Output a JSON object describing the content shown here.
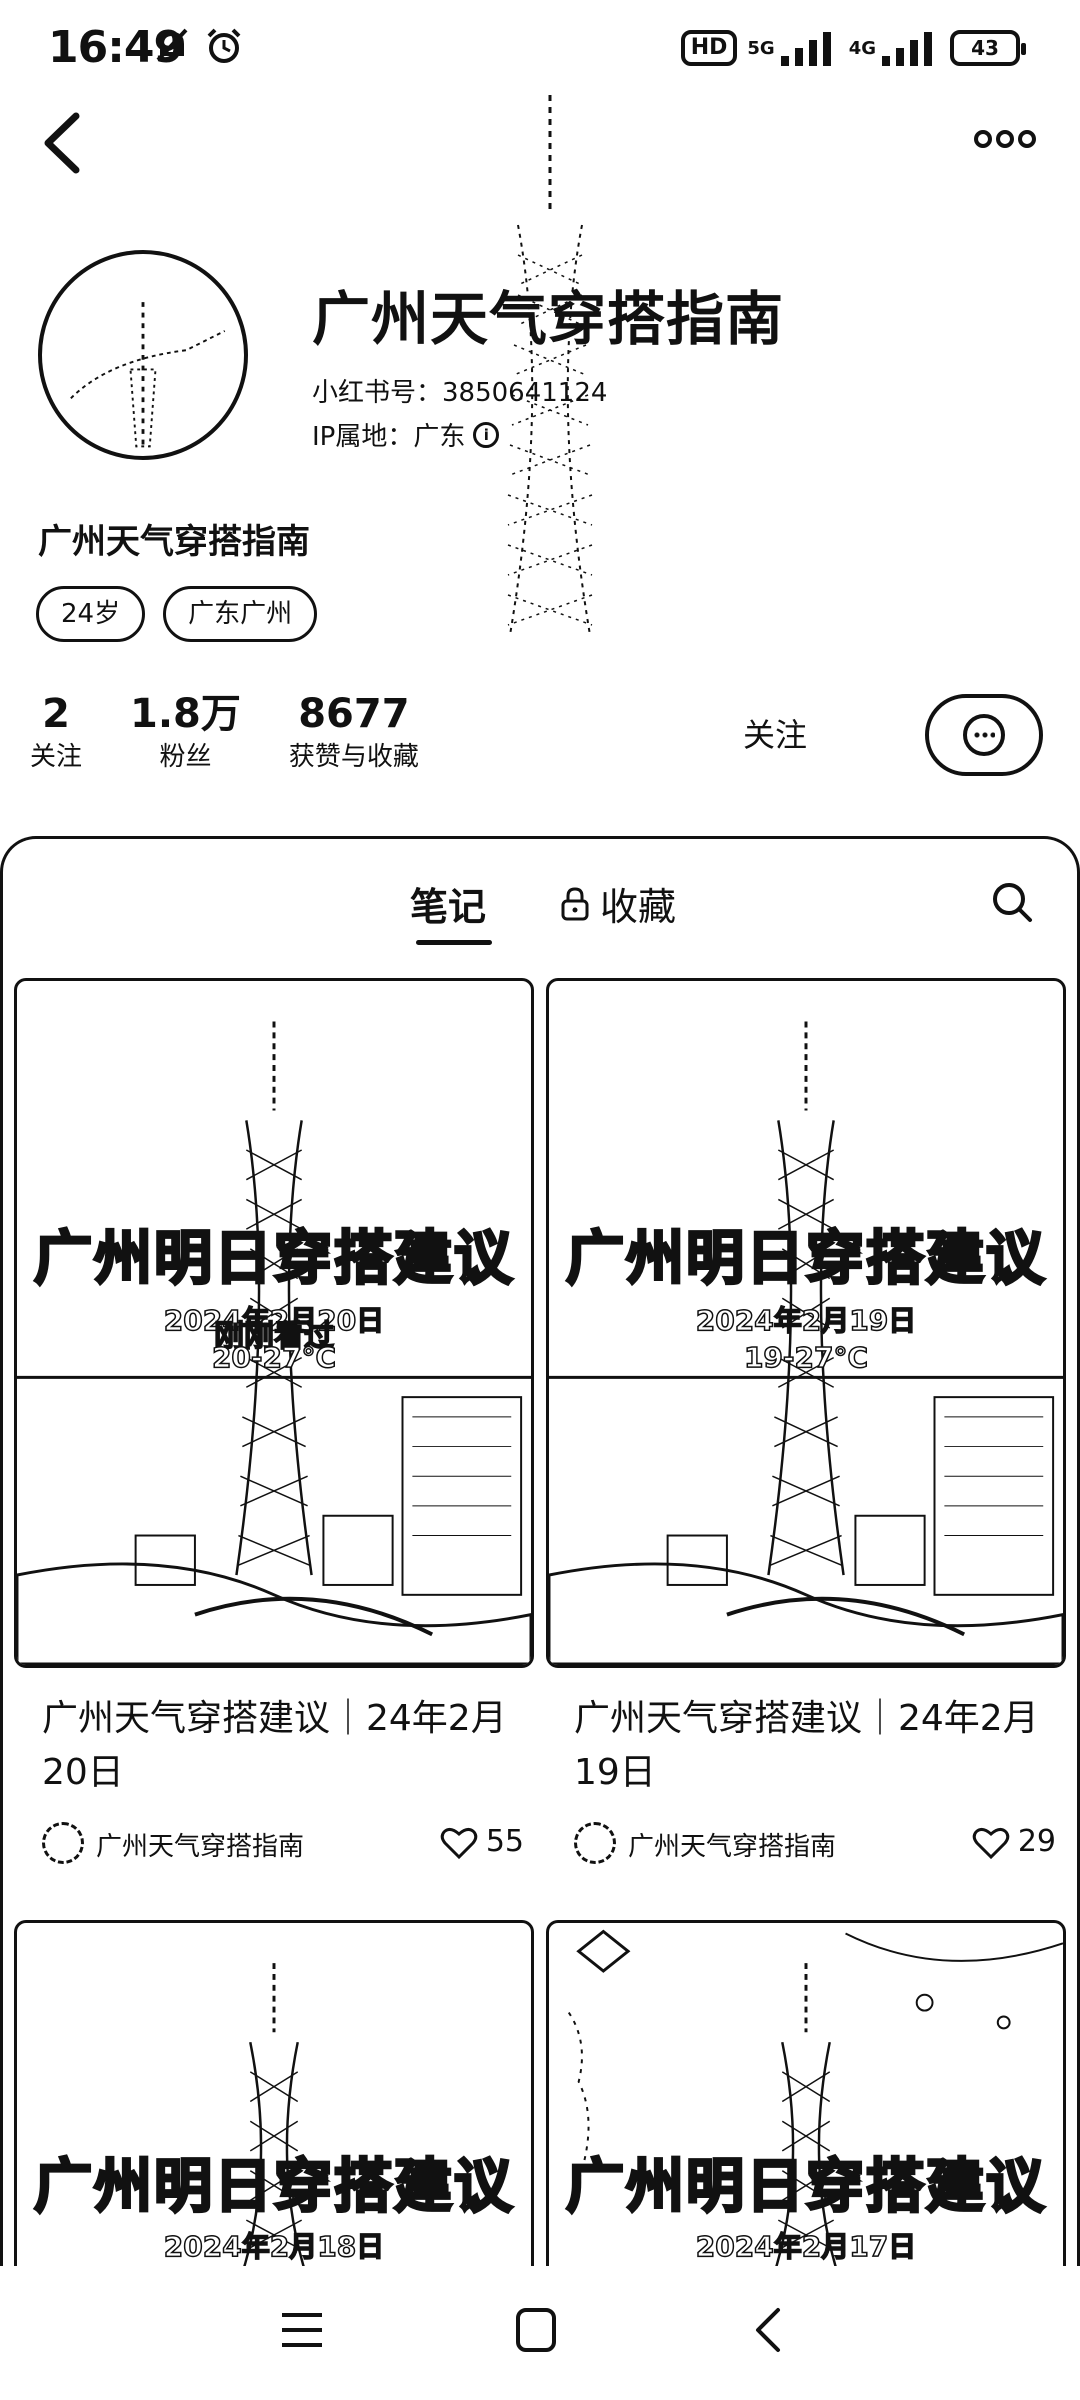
{
  "status_bar": {
    "time": "16:49",
    "hd_label": "HD",
    "network_5g": "5G",
    "network_4g": "4G",
    "battery": "43"
  },
  "profile": {
    "name": "广州天气穿搭指南",
    "redbook_id": "小红书号：3850641124",
    "ip_location": "IP属地：广东",
    "tags": [
      "24岁",
      "广东广州"
    ],
    "stats": [
      {
        "value": "2",
        "label": "关注"
      },
      {
        "value": "1.8万",
        "label": "粉丝"
      },
      {
        "value": "8677",
        "label": "获赞与收藏"
      }
    ],
    "follow_label": "关注"
  },
  "tabs": {
    "notes": "笔记",
    "collections": "收藏"
  },
  "notes": [
    {
      "headline": "广州明日穿搭建议",
      "date": "2024年2月20日",
      "temp": "20-27°C",
      "overlay": "刚刚看过",
      "title": "广州天气穿搭建议｜24年2月20日",
      "author": "广州天气穿搭指南",
      "likes": "55"
    },
    {
      "headline": "广州明日穿搭建议",
      "date": "2024年2月19日",
      "temp": "19-27°C",
      "title": "广州天气穿搭建议｜24年2月19日",
      "author": "广州天气穿搭指南",
      "likes": "29"
    },
    {
      "headline": "广州明日穿搭建议",
      "date": "2024年2月18日"
    },
    {
      "headline": "广州明日穿搭建议",
      "date": "2024年2月17日"
    }
  ],
  "icons": {
    "back": "back-arrow-icon",
    "more": "more-dots-icon",
    "chat": "chat-bubble-icon",
    "lock": "lock-icon",
    "search": "search-icon",
    "heart": "heart-icon",
    "nav_menu": "menu-icon",
    "nav_home": "home-icon",
    "nav_back": "back-icon"
  }
}
